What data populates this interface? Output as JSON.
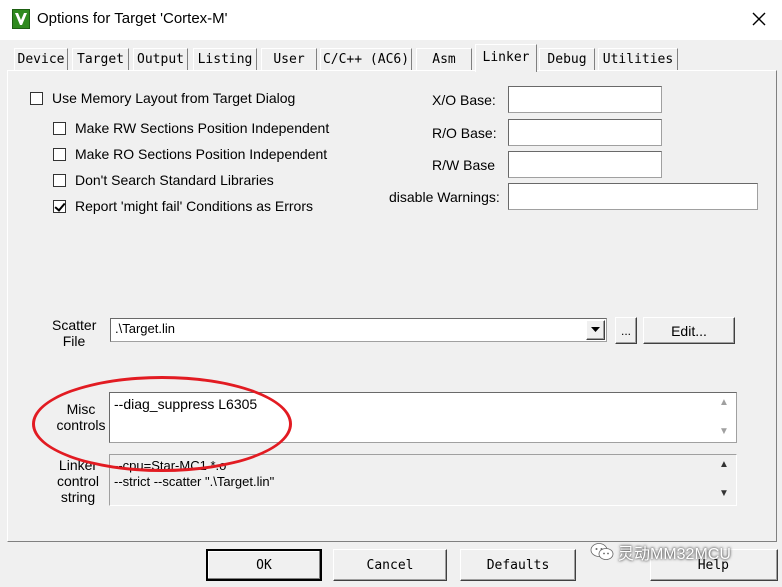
{
  "window": {
    "title": "Options for Target 'Cortex-M'"
  },
  "tabs": [
    {
      "label": "Device",
      "active": false
    },
    {
      "label": "Target",
      "active": false
    },
    {
      "label": "Output",
      "active": false
    },
    {
      "label": "Listing",
      "active": false
    },
    {
      "label": "User",
      "active": false
    },
    {
      "label": "C/C++ (AC6)",
      "active": false
    },
    {
      "label": "Asm",
      "active": false
    },
    {
      "label": "Linker",
      "active": true
    },
    {
      "label": "Debug",
      "active": false
    },
    {
      "label": "Utilities",
      "active": false
    }
  ],
  "linker": {
    "use_memory_layout": {
      "label": "Use Memory Layout from Target Dialog",
      "checked": false
    },
    "make_rw": {
      "label": "Make RW Sections Position Independent",
      "checked": false
    },
    "make_ro": {
      "label": "Make RO Sections Position Independent",
      "checked": false
    },
    "dont_search": {
      "label": "Don't Search Standard Libraries",
      "checked": false
    },
    "report_might_fail": {
      "label": "Report 'might fail' Conditions as Errors",
      "checked": true
    },
    "xo_base": {
      "label": "X/O Base:",
      "value": ""
    },
    "ro_base": {
      "label": "R/O Base:",
      "value": ""
    },
    "rw_base": {
      "label": "R/W Base",
      "value": ""
    },
    "disable_warnings": {
      "label": "disable Warnings:",
      "value": ""
    },
    "scatter_file": {
      "label_line1": "Scatter",
      "label_line2": "File",
      "value": ".\\Target.lin",
      "browse_label": "...",
      "edit_label": "Edit..."
    },
    "misc_controls": {
      "label_line1": "Misc",
      "label_line2": "controls",
      "value": "--diag_suppress L6305"
    },
    "control_string": {
      "label_line1": "Linker",
      "label_line2": "control",
      "label_line3": "string",
      "line1": "--cpu=Star-MC1 *.o",
      "line2": "--strict --scatter \".\\Target.lin\""
    }
  },
  "buttons": {
    "ok": "OK",
    "cancel": "Cancel",
    "defaults": "Defaults",
    "help": "Help"
  },
  "watermark": {
    "text": "灵动MM32MCU"
  },
  "colors": {
    "highlight_ellipse": "#e21b22",
    "dialog_bg": "#f0f0f0"
  }
}
